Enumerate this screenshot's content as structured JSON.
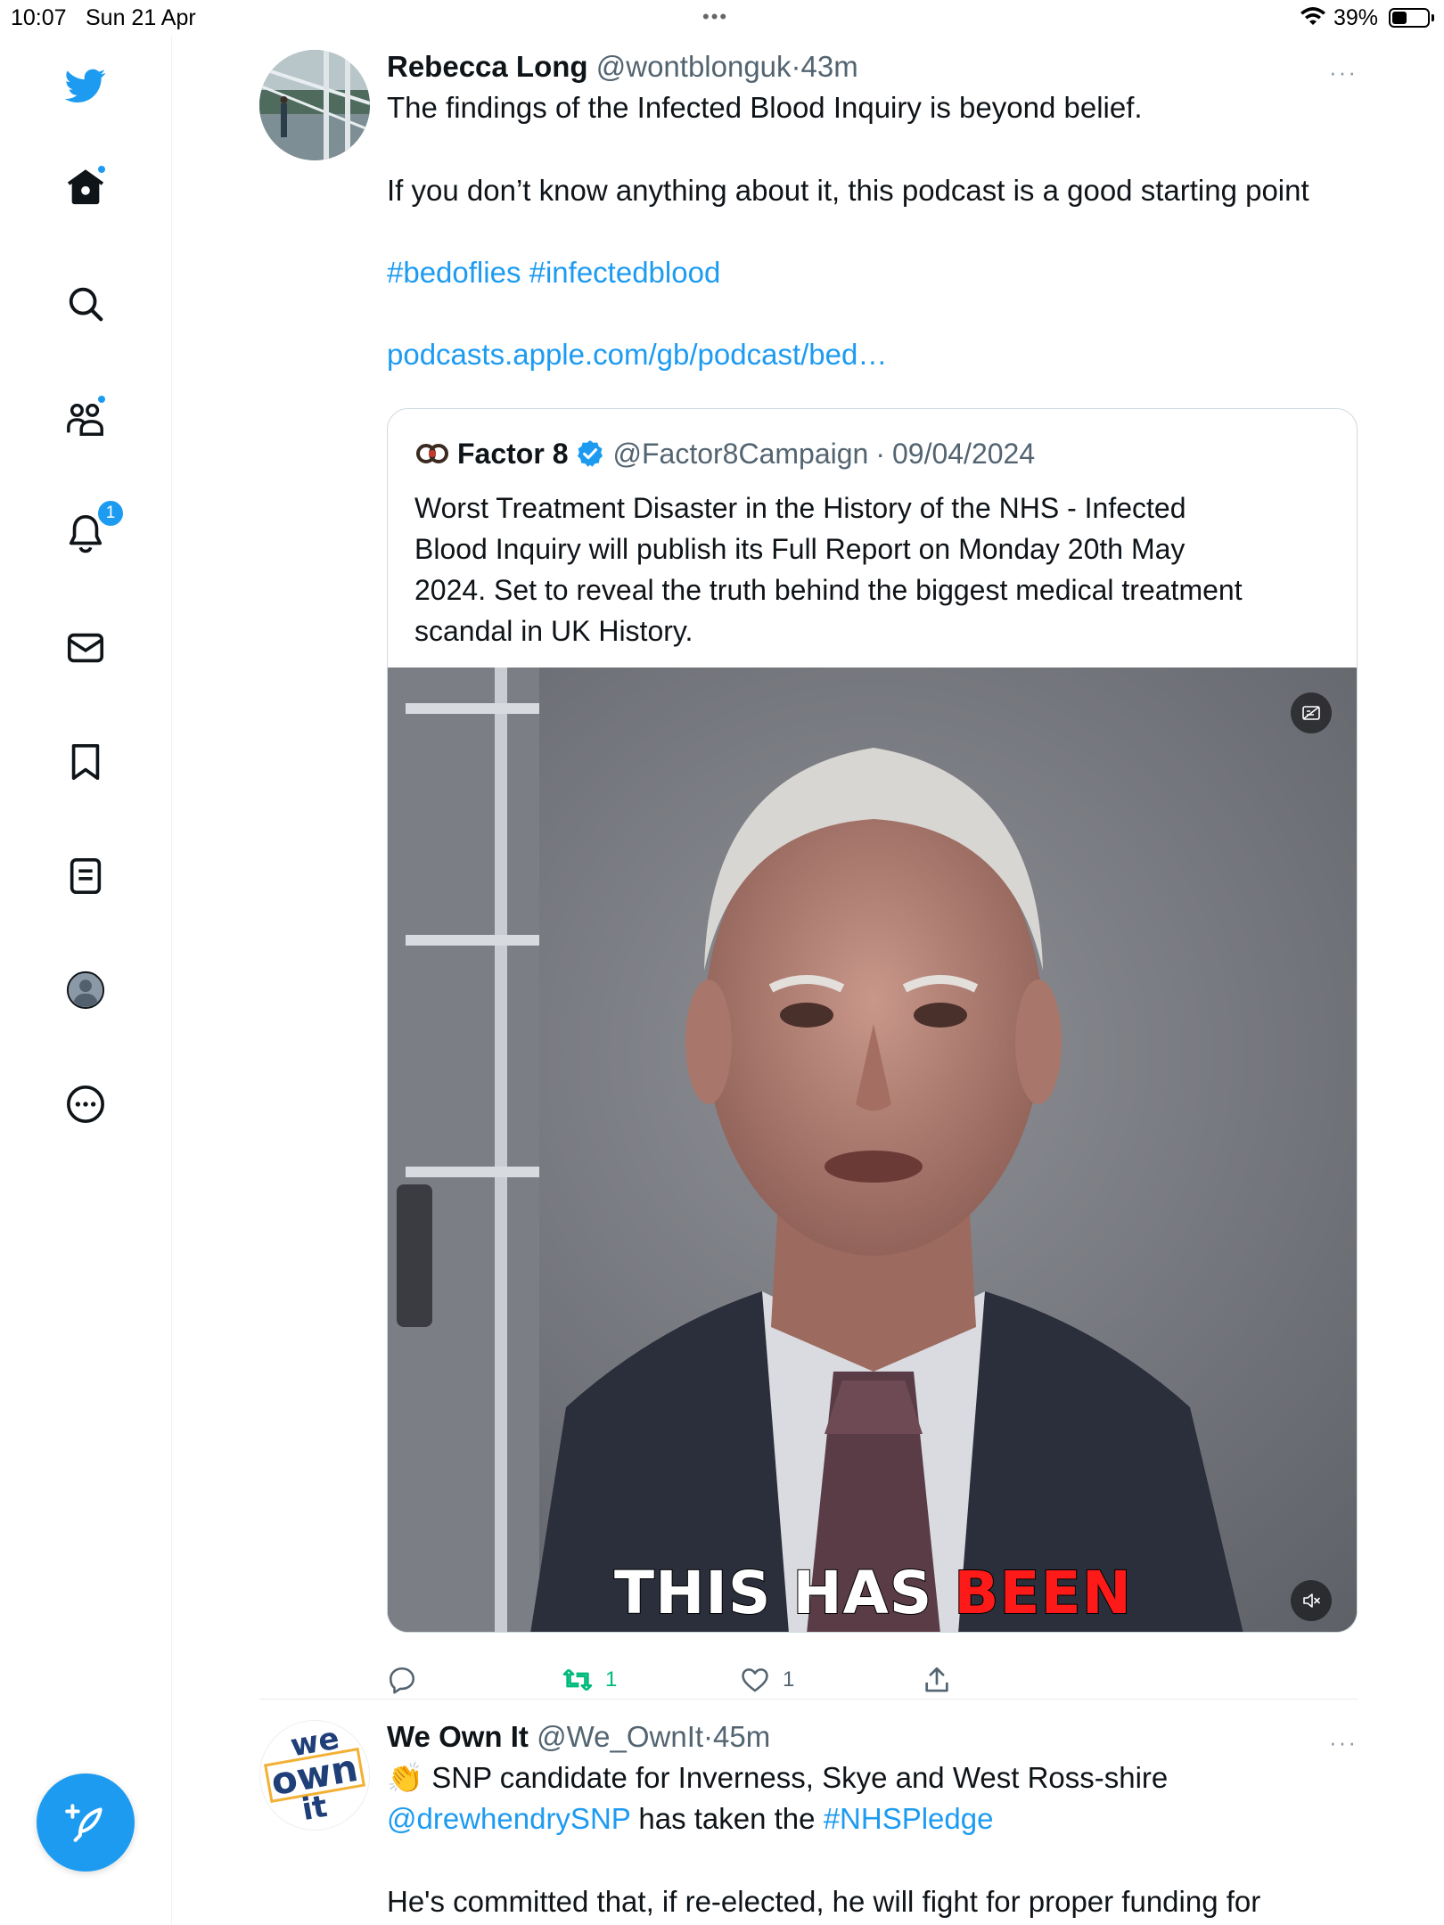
{
  "status_bar": {
    "time": "10:07",
    "date": "Sun 21 Apr",
    "dots": "•••",
    "battery_percent": "39%"
  },
  "sidebar": {
    "items": [
      {
        "name": "twitter-logo",
        "icon": "bird-icon"
      },
      {
        "name": "home",
        "icon": "home-icon",
        "has_dot": true
      },
      {
        "name": "search",
        "icon": "search-icon"
      },
      {
        "name": "communities",
        "icon": "communities-icon",
        "has_dot": true
      },
      {
        "name": "notifications",
        "icon": "bell-icon",
        "badge": "1"
      },
      {
        "name": "messages",
        "icon": "envelope-icon"
      },
      {
        "name": "bookmarks",
        "icon": "bookmark-icon"
      },
      {
        "name": "lists",
        "icon": "list-icon"
      },
      {
        "name": "profile",
        "icon": "profile-avatar-icon"
      },
      {
        "name": "more",
        "icon": "more-circle-icon"
      }
    ],
    "compose_icon": "compose-feather-icon"
  },
  "colors": {
    "accent": "#1d9bf0",
    "retweet_green": "#00ba7c",
    "muted_text": "#536471",
    "caption_red": "#ff1a1a"
  },
  "tweets": [
    {
      "author_name": "Rebecca Long",
      "handle": "@wontblonguk",
      "separator": "·",
      "time": "43m",
      "more": "···",
      "text_line1": "The findings of the Infected Blood Inquiry is beyond belief.",
      "text_line2": "If you don’t know anything about it, this podcast is a good starting point",
      "hashtags": "#bedoflies #infectedblood",
      "link": "podcasts.apple.com/gb/podcast/bed…",
      "quote": {
        "author_name": "Factor 8",
        "handle": "@Factor8Campaign",
        "separator": "·",
        "date": "09/04/2024",
        "lines": [
          "Worst Treatment Disaster in the History of the NHS - Infected",
          "Blood Inquiry will publish its Full Report on Monday 20th May",
          "2024. Set to reveal the truth behind the biggest medical treatment",
          "scandal in UK History."
        ],
        "video_caption_white": "THIS HAS",
        "video_caption_red": "BEEN"
      },
      "actions": {
        "reply_count": "",
        "retweet_count": "1",
        "like_count": "1"
      }
    },
    {
      "author_name": "We Own It",
      "handle": "@We_OwnIt",
      "separator": "·",
      "time": "45m",
      "more": "···",
      "avatar_text_1": "we",
      "avatar_text_2": "own",
      "avatar_text_3": "it",
      "emoji": "👏",
      "line1": "SNP candidate for Inverness, Skye and West Ross-shire",
      "mention": "@drewhendrySNP",
      "line2_mid": "has taken the",
      "hashtag": "#NHSPledge",
      "line3": "He's committed that, if re-elected, he will fight for proper funding for"
    }
  ]
}
